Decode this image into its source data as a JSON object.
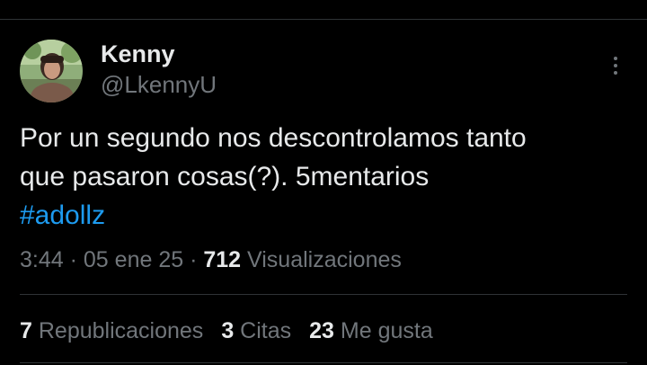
{
  "author": {
    "name": "Kenny",
    "handle": "@LkennyU"
  },
  "tweet": {
    "line1": "Por un segundo nos descontrolamos tanto",
    "line2": "que pasaron cosas(?). 5mentarios",
    "hashtag": "#adollz"
  },
  "meta": {
    "time": "3:44",
    "separator": "·",
    "date": "05 ene 25",
    "views_count": "712",
    "views_label": "Visualizaciones"
  },
  "stats": {
    "reposts_count": "7",
    "reposts_label": "Republicaciones",
    "quotes_count": "3",
    "quotes_label": "Citas",
    "likes_count": "23",
    "likes_label": "Me gusta"
  },
  "icons": {
    "more": "more-options-icon"
  },
  "colors": {
    "background": "#000000",
    "text": "#e7e9ea",
    "secondary": "#71767b",
    "link": "#1d9bf0",
    "divider": "#2f3336"
  }
}
